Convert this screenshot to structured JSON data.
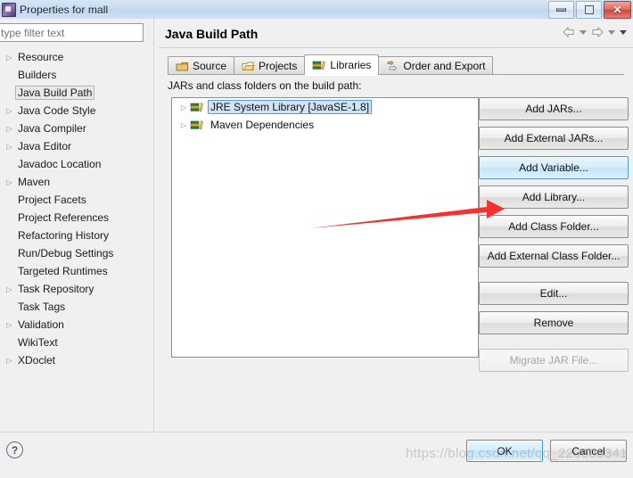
{
  "window": {
    "title": "Properties for mall",
    "icon": "properties-app-icon",
    "controls": {
      "minimize": "minimize-icon",
      "maximize": "maximize-icon",
      "close": "close-icon"
    }
  },
  "sidebar": {
    "filter": {
      "value": "",
      "placeholder": "type filter text"
    },
    "items": [
      {
        "label": "Resource",
        "expandable": true,
        "selected": false
      },
      {
        "label": "Builders",
        "expandable": false,
        "selected": false
      },
      {
        "label": "Java Build Path",
        "expandable": false,
        "selected": true
      },
      {
        "label": "Java Code Style",
        "expandable": true,
        "selected": false
      },
      {
        "label": "Java Compiler",
        "expandable": true,
        "selected": false
      },
      {
        "label": "Java Editor",
        "expandable": true,
        "selected": false
      },
      {
        "label": "Javadoc Location",
        "expandable": false,
        "selected": false
      },
      {
        "label": "Maven",
        "expandable": true,
        "selected": false
      },
      {
        "label": "Project Facets",
        "expandable": false,
        "selected": false
      },
      {
        "label": "Project References",
        "expandable": false,
        "selected": false
      },
      {
        "label": "Refactoring History",
        "expandable": false,
        "selected": false
      },
      {
        "label": "Run/Debug Settings",
        "expandable": false,
        "selected": false
      },
      {
        "label": "Targeted Runtimes",
        "expandable": false,
        "selected": false
      },
      {
        "label": "Task Repository",
        "expandable": true,
        "selected": false
      },
      {
        "label": "Task Tags",
        "expandable": false,
        "selected": false
      },
      {
        "label": "Validation",
        "expandable": true,
        "selected": false
      },
      {
        "label": "WikiText",
        "expandable": false,
        "selected": false
      },
      {
        "label": "XDoclet",
        "expandable": true,
        "selected": false
      }
    ]
  },
  "page": {
    "title": "Java Build Path",
    "nav": {
      "back": "back-arrow-icon",
      "back_menu": "chevron-down-icon",
      "forward": "forward-arrow-icon",
      "forward_menu": "chevron-down-icon",
      "view_menu": "view-menu-icon"
    },
    "tabs": [
      {
        "label": "Source",
        "icon": "package-icon",
        "active": false
      },
      {
        "label": "Projects",
        "icon": "folder-icon",
        "active": false
      },
      {
        "label": "Libraries",
        "icon": "library-books-icon",
        "active": true
      },
      {
        "label": "Order and Export",
        "icon": "order-export-icon",
        "active": false
      }
    ],
    "section_label": "JARs and class folders on the build path:",
    "entries": [
      {
        "label": "JRE System Library [JavaSE-1.8]",
        "icon": "library-books-icon",
        "expandable": true,
        "selected": true
      },
      {
        "label": "Maven Dependencies",
        "icon": "library-books-icon",
        "expandable": true,
        "selected": false
      }
    ],
    "buttons": [
      {
        "label": "Add JARs...",
        "state": "normal"
      },
      {
        "label": "Add External JARs...",
        "state": "normal"
      },
      {
        "label": "Add Variable...",
        "state": "hover"
      },
      {
        "label": "Add Library...",
        "state": "normal"
      },
      {
        "label": "Add Class Folder...",
        "state": "normal"
      },
      {
        "label": "Add External Class Folder...",
        "state": "normal"
      },
      {
        "label": "Edit...",
        "state": "normal",
        "gap": true
      },
      {
        "label": "Remove",
        "state": "normal"
      },
      {
        "label": "Migrate JAR File...",
        "state": "disabled",
        "gap": true
      }
    ]
  },
  "footer": {
    "help": "?",
    "ok_label": "OK",
    "cancel_label": "Cancel"
  },
  "overlay": {
    "watermark": "https://blog.csdn.net/qq_223000341",
    "arrow": "red-pointer-arrow"
  },
  "colors": {
    "accent": "#3e93cf",
    "selection": "#cfe4f7",
    "annotation": "#f83030",
    "titlebar": "#c9dcf0"
  }
}
